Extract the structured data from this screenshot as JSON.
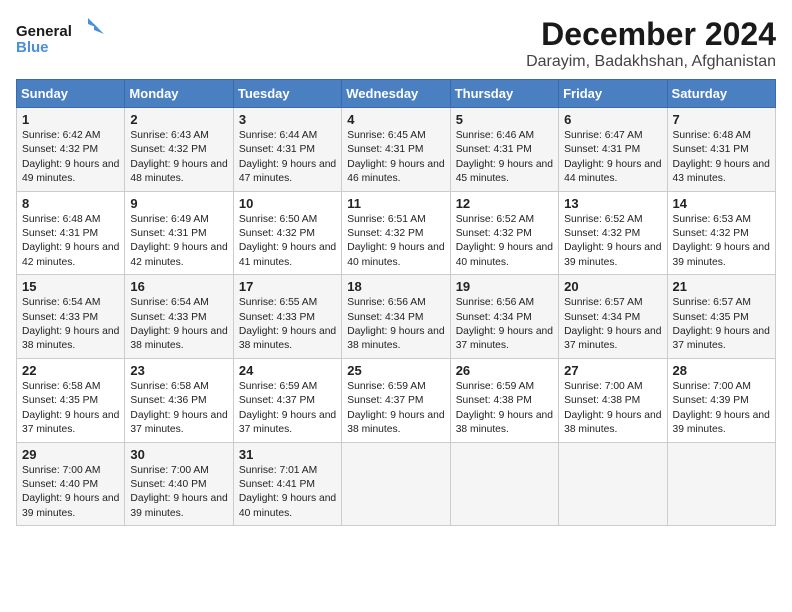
{
  "header": {
    "logo_line1": "General",
    "logo_line2": "Blue",
    "month_title": "December 2024",
    "location": "Darayim, Badakhshan, Afghanistan"
  },
  "weekdays": [
    "Sunday",
    "Monday",
    "Tuesday",
    "Wednesday",
    "Thursday",
    "Friday",
    "Saturday"
  ],
  "weeks": [
    [
      {
        "day": "1",
        "sunrise": "6:42 AM",
        "sunset": "4:32 PM",
        "daylight": "9 hours and 49 minutes."
      },
      {
        "day": "2",
        "sunrise": "6:43 AM",
        "sunset": "4:32 PM",
        "daylight": "9 hours and 48 minutes."
      },
      {
        "day": "3",
        "sunrise": "6:44 AM",
        "sunset": "4:31 PM",
        "daylight": "9 hours and 47 minutes."
      },
      {
        "day": "4",
        "sunrise": "6:45 AM",
        "sunset": "4:31 PM",
        "daylight": "9 hours and 46 minutes."
      },
      {
        "day": "5",
        "sunrise": "6:46 AM",
        "sunset": "4:31 PM",
        "daylight": "9 hours and 45 minutes."
      },
      {
        "day": "6",
        "sunrise": "6:47 AM",
        "sunset": "4:31 PM",
        "daylight": "9 hours and 44 minutes."
      },
      {
        "day": "7",
        "sunrise": "6:48 AM",
        "sunset": "4:31 PM",
        "daylight": "9 hours and 43 minutes."
      }
    ],
    [
      {
        "day": "8",
        "sunrise": "6:48 AM",
        "sunset": "4:31 PM",
        "daylight": "9 hours and 42 minutes."
      },
      {
        "day": "9",
        "sunrise": "6:49 AM",
        "sunset": "4:31 PM",
        "daylight": "9 hours and 42 minutes."
      },
      {
        "day": "10",
        "sunrise": "6:50 AM",
        "sunset": "4:32 PM",
        "daylight": "9 hours and 41 minutes."
      },
      {
        "day": "11",
        "sunrise": "6:51 AM",
        "sunset": "4:32 PM",
        "daylight": "9 hours and 40 minutes."
      },
      {
        "day": "12",
        "sunrise": "6:52 AM",
        "sunset": "4:32 PM",
        "daylight": "9 hours and 40 minutes."
      },
      {
        "day": "13",
        "sunrise": "6:52 AM",
        "sunset": "4:32 PM",
        "daylight": "9 hours and 39 minutes."
      },
      {
        "day": "14",
        "sunrise": "6:53 AM",
        "sunset": "4:32 PM",
        "daylight": "9 hours and 39 minutes."
      }
    ],
    [
      {
        "day": "15",
        "sunrise": "6:54 AM",
        "sunset": "4:33 PM",
        "daylight": "9 hours and 38 minutes."
      },
      {
        "day": "16",
        "sunrise": "6:54 AM",
        "sunset": "4:33 PM",
        "daylight": "9 hours and 38 minutes."
      },
      {
        "day": "17",
        "sunrise": "6:55 AM",
        "sunset": "4:33 PM",
        "daylight": "9 hours and 38 minutes."
      },
      {
        "day": "18",
        "sunrise": "6:56 AM",
        "sunset": "4:34 PM",
        "daylight": "9 hours and 38 minutes."
      },
      {
        "day": "19",
        "sunrise": "6:56 AM",
        "sunset": "4:34 PM",
        "daylight": "9 hours and 37 minutes."
      },
      {
        "day": "20",
        "sunrise": "6:57 AM",
        "sunset": "4:34 PM",
        "daylight": "9 hours and 37 minutes."
      },
      {
        "day": "21",
        "sunrise": "6:57 AM",
        "sunset": "4:35 PM",
        "daylight": "9 hours and 37 minutes."
      }
    ],
    [
      {
        "day": "22",
        "sunrise": "6:58 AM",
        "sunset": "4:35 PM",
        "daylight": "9 hours and 37 minutes."
      },
      {
        "day": "23",
        "sunrise": "6:58 AM",
        "sunset": "4:36 PM",
        "daylight": "9 hours and 37 minutes."
      },
      {
        "day": "24",
        "sunrise": "6:59 AM",
        "sunset": "4:37 PM",
        "daylight": "9 hours and 37 minutes."
      },
      {
        "day": "25",
        "sunrise": "6:59 AM",
        "sunset": "4:37 PM",
        "daylight": "9 hours and 38 minutes."
      },
      {
        "day": "26",
        "sunrise": "6:59 AM",
        "sunset": "4:38 PM",
        "daylight": "9 hours and 38 minutes."
      },
      {
        "day": "27",
        "sunrise": "7:00 AM",
        "sunset": "4:38 PM",
        "daylight": "9 hours and 38 minutes."
      },
      {
        "day": "28",
        "sunrise": "7:00 AM",
        "sunset": "4:39 PM",
        "daylight": "9 hours and 39 minutes."
      }
    ],
    [
      {
        "day": "29",
        "sunrise": "7:00 AM",
        "sunset": "4:40 PM",
        "daylight": "9 hours and 39 minutes."
      },
      {
        "day": "30",
        "sunrise": "7:00 AM",
        "sunset": "4:40 PM",
        "daylight": "9 hours and 39 minutes."
      },
      {
        "day": "31",
        "sunrise": "7:01 AM",
        "sunset": "4:41 PM",
        "daylight": "9 hours and 40 minutes."
      },
      null,
      null,
      null,
      null
    ]
  ],
  "labels": {
    "sunrise_prefix": "Sunrise: ",
    "sunset_prefix": "Sunset: ",
    "daylight_prefix": "Daylight: "
  }
}
